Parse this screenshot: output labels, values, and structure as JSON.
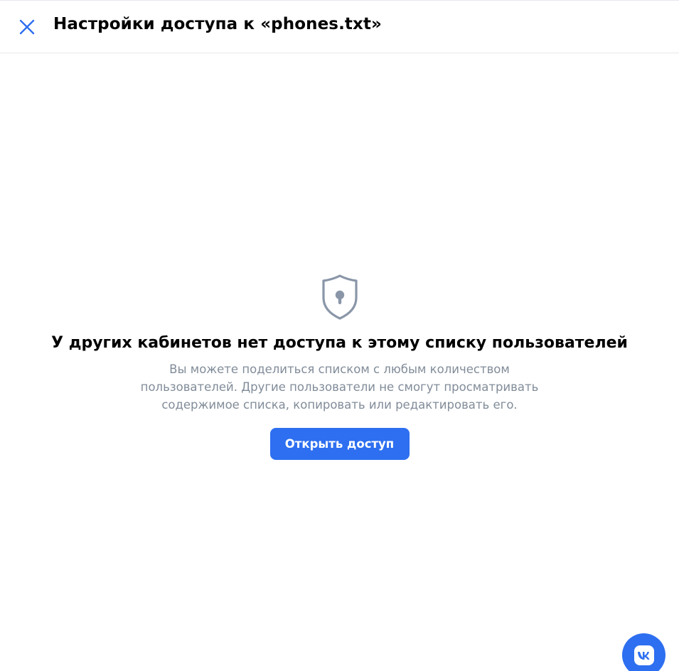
{
  "header": {
    "title": "Настройки доступа к «phones.txt»",
    "close_icon": "close-icon"
  },
  "empty_state": {
    "icon": "shield-keyhole-icon",
    "title": "У других кабинетов нет доступа к этому списку пользователей",
    "description_lines": [
      "Вы можете поделиться списком с любым количеством",
      "пользователей. Другие пользователи не смогут просматривать",
      "содержимое списка, копировать или редактировать его."
    ],
    "button_label": "Открыть доступ"
  },
  "fab": {
    "icon": "vk-logo-icon"
  },
  "colors": {
    "accent": "#2d6ff0",
    "text_primary": "#000000",
    "text_secondary": "#818c99",
    "divider": "#e7e8ec",
    "icon_gray": "#8a96a8"
  }
}
